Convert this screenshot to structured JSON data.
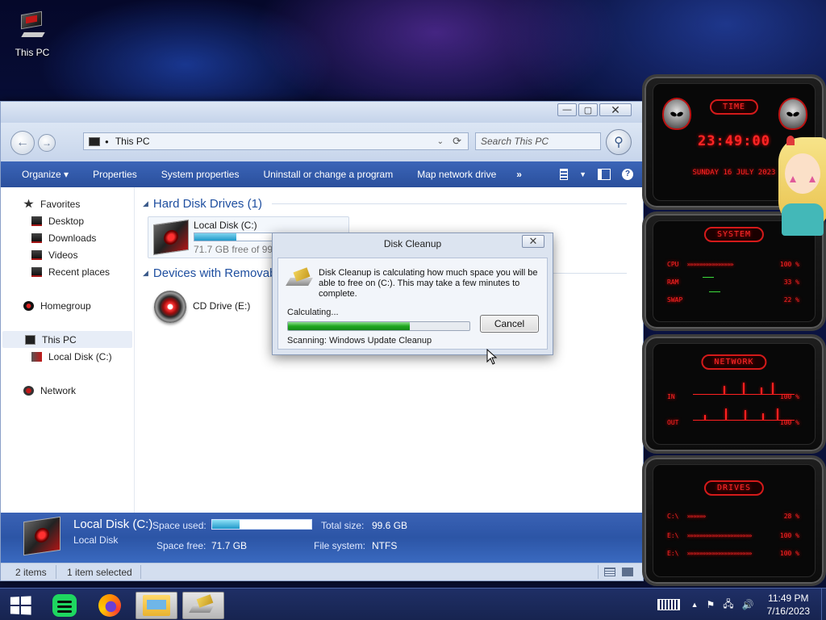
{
  "desktop": {
    "this_pc_label": "This PC"
  },
  "explorer": {
    "window_buttons": {
      "minimize": "—",
      "maximize": "▢",
      "close": "✕"
    },
    "address": {
      "path": "This PC",
      "dropdown_glyph": "⌄",
      "refresh_glyph": "⟳"
    },
    "search": {
      "placeholder": "Search This PC"
    },
    "toolbar": {
      "organize": "Organize ▾",
      "properties": "Properties",
      "system_properties": "System properties",
      "uninstall": "Uninstall or change a program",
      "map_network_drive": "Map network drive",
      "more": "»"
    },
    "nav": {
      "favorites": "Favorites",
      "desktop": "Desktop",
      "downloads": "Downloads",
      "videos": "Videos",
      "recent_places": "Recent places",
      "homegroup": "Homegroup",
      "this_pc": "This PC",
      "local_disk": "Local Disk (C:)",
      "network": "Network"
    },
    "groups": {
      "hard_disk": "Hard Disk Drives (1)",
      "removable": "Devices with Removable Storage (1)"
    },
    "drive": {
      "name": "Local Disk (C:)",
      "free_text": "71.7 GB free of 99.6 GB",
      "used_fraction": 0.28
    },
    "cd_drive": {
      "name": "CD Drive (E:)"
    },
    "details": {
      "title": "Local Disk (C:)",
      "subtitle": "Local Disk",
      "space_used_label": "Space used:",
      "space_used_fraction": 0.28,
      "space_free_label": "Space free:",
      "space_free_value": "71.7 GB",
      "total_size_label": "Total size:",
      "total_size_value": "99.6 GB",
      "file_system_label": "File system:",
      "file_system_value": "NTFS"
    },
    "status": {
      "items": "2 items",
      "selected": "1 item selected"
    }
  },
  "dialog": {
    "title": "Disk Cleanup",
    "close_glyph": "✕",
    "message": "Disk Cleanup is calculating how much space you will be able to free on  (C:). This may take a few minutes to complete.",
    "calculating": "Calculating...",
    "progress_fraction": 0.67,
    "cancel": "Cancel",
    "scanning": "Scanning:  Windows Update Cleanup"
  },
  "widgets": {
    "time": {
      "title": "TIME",
      "clock": "23:49:00",
      "date": "SUNDAY 16 JULY 2023"
    },
    "system": {
      "title": "SYSTEM",
      "cpu_label": "CPU",
      "cpu_bars": "»»»»»»»»»»»»»»»",
      "cpu_value": "100 %",
      "ram_label": "RAM",
      "ram_value": "33 %",
      "swap_label": "SWAP",
      "swap_value": "22 %"
    },
    "network": {
      "title": "NETWORK",
      "in_label": "IN",
      "in_value": "100 %",
      "out_label": "OUT",
      "out_value": "100 %"
    },
    "drives": {
      "title": "DRIVES",
      "rows": [
        {
          "label": "C:\\",
          "bars": "»»»»»»",
          "value": "28 %"
        },
        {
          "label": "E:\\",
          "bars": "»»»»»»»»»»»»»»»»»»»»»",
          "value": "100 %"
        },
        {
          "label": "E:\\",
          "bars": "»»»»»»»»»»»»»»»»»»»»»",
          "value": "100 %"
        }
      ]
    }
  },
  "taskbar": {
    "clock_time": "11:49 PM",
    "clock_date": "7/16/2023",
    "tray_up": "▲",
    "tray_flag": "⚑",
    "tray_network": "🖧",
    "tray_volume": "🔊"
  },
  "colors": {
    "explorer_blue": "#2a4f9c",
    "accent_red": "#ff2525",
    "progress_green": "#1ea71e",
    "drive_bar": "#1f98c9"
  }
}
